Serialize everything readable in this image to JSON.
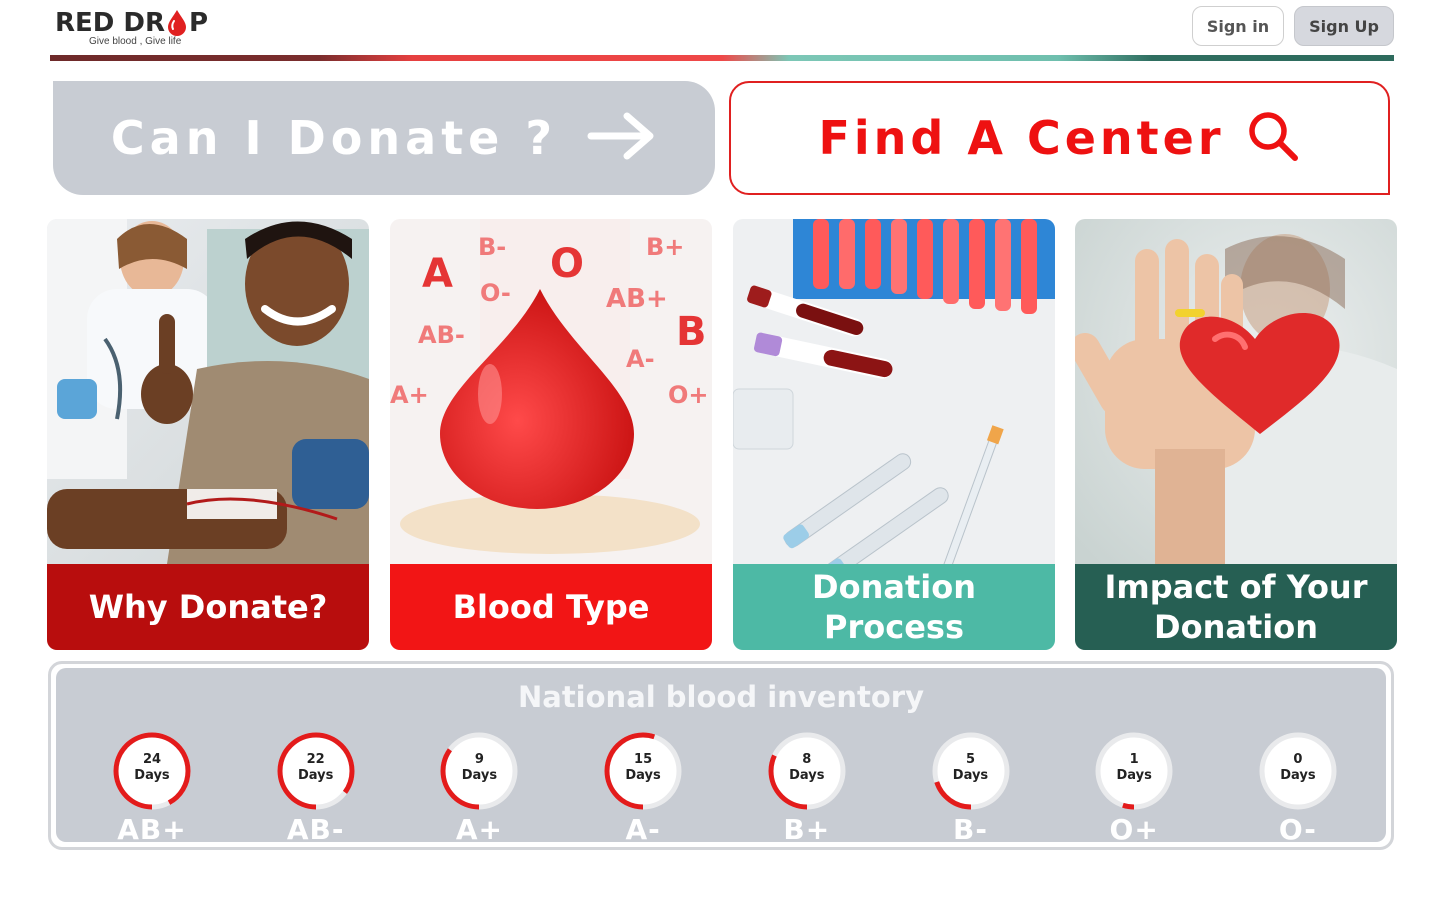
{
  "brand": {
    "name_part1": "RED DR",
    "name_part2": "P",
    "tagline": "Give blood , Give life",
    "primary_color": "#e02020",
    "dark_color": "#2b2b2b"
  },
  "auth": {
    "sign_in": "Sign in",
    "sign_up": "Sign Up"
  },
  "actions": {
    "can_donate": {
      "label": "Can I Donate ?",
      "icon": "arrow-right-icon"
    },
    "find_center": {
      "label": "Find A Center",
      "icon": "search-icon"
    }
  },
  "cards": [
    {
      "title": "Why Donate?",
      "image": "smiling-donor-photo",
      "color": "#b80d0d"
    },
    {
      "title": "Blood Type",
      "image": "blood-drop-types-illustration",
      "color": "#f21515"
    },
    {
      "title": "Donation Process",
      "image": "blood-test-tubes-photo",
      "color": "#4db9a5"
    },
    {
      "title": "Impact of Your Donation",
      "image": "hand-heart-photo",
      "color": "#265f53"
    }
  ],
  "blood_type_labels": [
    "A",
    "B-",
    "O",
    "B+",
    "O-",
    "AB+",
    "B",
    "AB-",
    "A-",
    "A+",
    "O+"
  ],
  "inventory": {
    "title": "National blood inventory",
    "unit": "Days",
    "items": [
      {
        "type": "AB+",
        "days": "24",
        "level": 0.92
      },
      {
        "type": "AB-",
        "days": "22",
        "level": 0.85
      },
      {
        "type": "A+",
        "days": "9",
        "level": 0.35
      },
      {
        "type": "A-",
        "days": "15",
        "level": 0.55
      },
      {
        "type": "B+",
        "days": "8",
        "level": 0.32
      },
      {
        "type": "B-",
        "days": "5",
        "level": 0.2
      },
      {
        "type": "O+",
        "days": "1",
        "level": 0.05
      },
      {
        "type": "O-",
        "days": "0",
        "level": 0.0
      }
    ]
  }
}
